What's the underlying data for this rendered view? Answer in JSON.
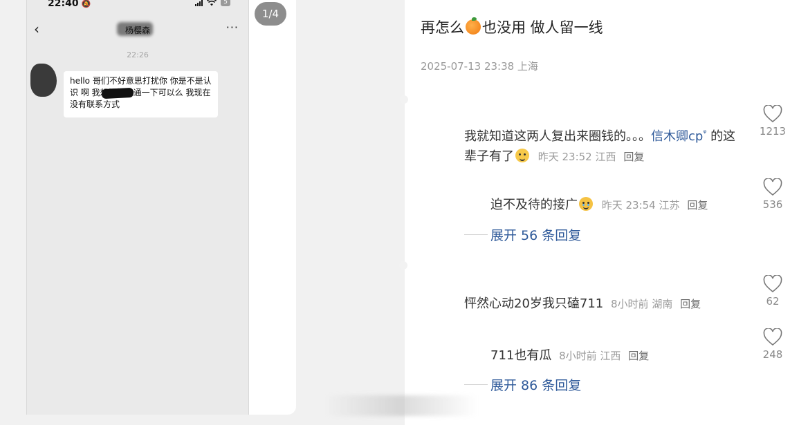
{
  "left": {
    "status_time": "22:40",
    "battery": "5",
    "chat_name": "杨樱森",
    "chat_time": "22:26",
    "message": "hello 哥们不好意思打扰你 你是不是认识 啊 我想跟她沟通一下可以么 我现在没有联系方式",
    "page_indicator": "1/4",
    "back_glyph": "‹",
    "more_glyph": "···"
  },
  "post": {
    "title_before": "再怎么",
    "title_after": "也没用 做人留一线",
    "meta": "2025-07-13 23:38 上海"
  },
  "comments": [
    {
      "text_a": "我就知道这两人复出来圈钱的。。。",
      "mention": "信木卿cp",
      "mention_ext": "ᵠ",
      "text_b": "的这辈子有了",
      "time": "昨天 23:52",
      "location": "江西",
      "reply": "回复",
      "likes": "1213"
    },
    {
      "text": "迫不及待的接广",
      "time": "昨天 23:54",
      "location": "江苏",
      "reply": "回复",
      "likes": "536"
    },
    {
      "text": "怦然心动20岁我只磕711",
      "time": "8小时前",
      "location": "湖南",
      "reply": "回复",
      "likes": "62"
    },
    {
      "text": "711也有瓜",
      "time": "8小时前",
      "location": "江西",
      "reply": "回复",
      "likes": "248"
    }
  ],
  "expand": [
    {
      "label": "展开 56 条回复"
    },
    {
      "label": "展开 86 条回复"
    }
  ],
  "icons": {
    "heart": "heart-outline",
    "orange": "tangerine-emoji",
    "smile": "smile-emoji",
    "cry": "crying-emoji"
  },
  "colors": {
    "link": "#2f5a9a",
    "meta": "#9a9a9a",
    "page_bg": "#f1f1f1"
  }
}
